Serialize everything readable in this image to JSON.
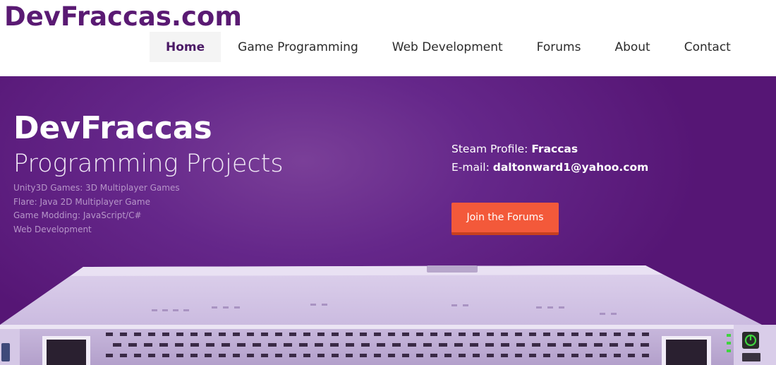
{
  "header": {
    "logo": "DevFraccas.com",
    "nav": [
      {
        "label": "Home",
        "active": true
      },
      {
        "label": "Game Programming",
        "active": false
      },
      {
        "label": "Web Development",
        "active": false
      },
      {
        "label": "Forums",
        "active": false
      },
      {
        "label": "About",
        "active": false
      },
      {
        "label": "Contact",
        "active": false
      }
    ]
  },
  "hero": {
    "title": "DevFraccas",
    "subtitle": "Programming Projects",
    "projects": [
      "Unity3D Games: 3D Multiplayer Games",
      "Flare: Java 2D Multiplayer Game",
      "Game Modding: JavaScript/C#",
      "Web Development"
    ],
    "steam_label": "Steam Profile: ",
    "steam_value": "Fraccas",
    "email_label": "E-mail: ",
    "email_value": "daltonward1@yahoo.com",
    "cta_label": "Join the Forums",
    "illustration": "rack-server",
    "colors": {
      "brand": "#5a1a73",
      "hero_bg": "#65278a",
      "cta": "#f3593a",
      "power_led": "#3fd43f"
    }
  }
}
